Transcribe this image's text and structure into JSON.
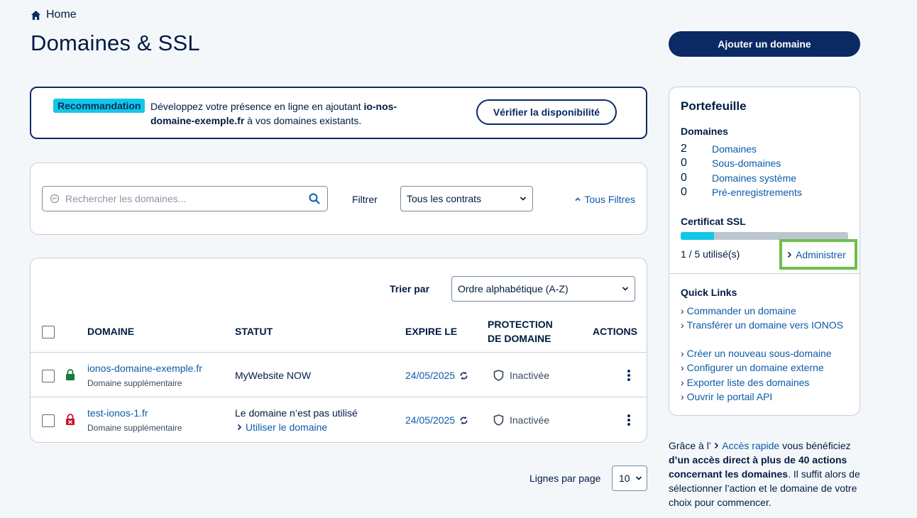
{
  "breadcrumb": {
    "home_label": "Home"
  },
  "page": {
    "title": "Domaines & SSL",
    "add_domain_button": "Ajouter un domaine"
  },
  "recommendation": {
    "badge": "Recommandation",
    "text_before": "Développez votre présence en ligne en ajoutant ",
    "domain": "io-nos-domaine-exemple.fr",
    "text_after": " à vos domaines existants.",
    "check_button": "Vérifier la disponibilité"
  },
  "search": {
    "placeholder": "Rechercher les domaines...",
    "filter_label": "Filtrer",
    "contract_select": "Tous les contrats",
    "all_filters": "Tous Filtres"
  },
  "table": {
    "sort_label": "Trier par",
    "sort_select": "Ordre alphabétique (A-Z)",
    "headers": {
      "domain": "DOMAINE",
      "status": "STATUT",
      "expires": "EXPIRE LE",
      "protection_line1": "PROTECTION",
      "protection_line2": "DE DOMAINE",
      "actions": "ACTIONS"
    },
    "rows": [
      {
        "domain": "ionos-domaine-exemple.fr",
        "type": "Domaine supplémentaire",
        "status": "MyWebsite NOW",
        "status_link": "",
        "expires": "24/05/2025",
        "protection": "Inactivée",
        "lock": "locked"
      },
      {
        "domain": "test-ionos-1.fr",
        "type": "Domaine supplémentaire",
        "status": "Le domaine n’est pas utilisé",
        "status_link": "Utiliser le domaine",
        "expires": "24/05/2025",
        "protection": "Inactivée",
        "lock": "error"
      }
    ]
  },
  "pagination": {
    "label": "Lignes par page",
    "value": "10"
  },
  "portfolio": {
    "title": "Portefeuille",
    "domains_heading": "Domaines",
    "domains": [
      {
        "count": "2",
        "label": "Domaines"
      },
      {
        "count": "0",
        "label": "Sous-domaines"
      },
      {
        "count": "0",
        "label": "Domaines système"
      },
      {
        "count": "0",
        "label": "Pré-enregistrements"
      }
    ],
    "ssl_heading": "Certificat SSL",
    "ssl_used_fraction": 0.2,
    "ssl_used_text": "1 / 5 utilisé(s)",
    "administer": "Administrer",
    "quick_links_heading": "Quick Links",
    "quick_links": [
      "Commander un domaine",
      "Transférer un domaine vers IONOS",
      "Créer un nouveau sous-domaine",
      "Configurer un domaine externe",
      "Exporter liste des domaines",
      "Ouvrir le portail API"
    ]
  },
  "info": {
    "text_before": "Grâce à l’ ",
    "link": "Accès rapide",
    "text_mid": " vous bénéficiez ",
    "bold": "d’un accès direct à plus de 40 actions concernant les domaines",
    "text_after": ". Il suffit alors de sélectionner l’action et le domaine de votre choix pour commencer."
  },
  "colors": {
    "navy": "#0b2a63",
    "accent": "#11c7e6",
    "link": "#0b5ba8",
    "highlight": "#6cc04a",
    "lock_ok": "#1a7a3a",
    "lock_error": "#c8102e"
  }
}
